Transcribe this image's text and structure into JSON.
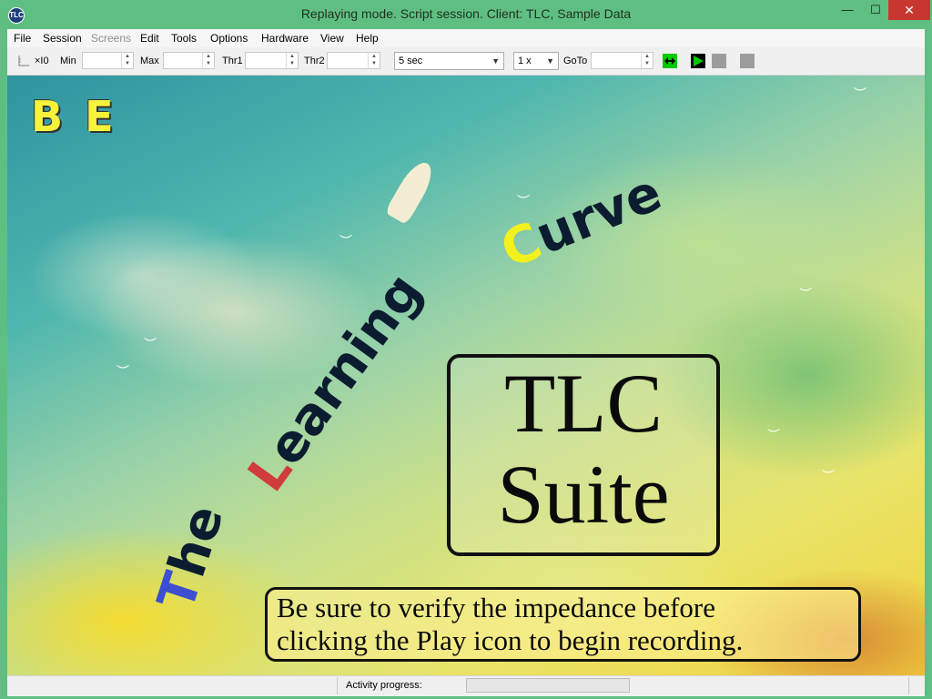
{
  "window": {
    "title": "Replaying mode. Script session. Client: TLC, Sample Data",
    "app_icon": "tlc-app-icon",
    "controls": {
      "minimize": "—",
      "maximize": "☐",
      "close": "✕"
    }
  },
  "menubar": {
    "items": [
      {
        "label": "File",
        "enabled": true
      },
      {
        "label": "Session",
        "enabled": true
      },
      {
        "label": "Screens",
        "enabled": false
      },
      {
        "label": "Edit",
        "enabled": true
      },
      {
        "label": "Tools",
        "enabled": true
      },
      {
        "label": "Options",
        "enabled": true
      },
      {
        "label": "Hardware",
        "enabled": true
      },
      {
        "label": "View",
        "enabled": true
      },
      {
        "label": "Help",
        "enabled": true
      }
    ]
  },
  "toolbar": {
    "scale_label": "×I0",
    "min_label": "Min",
    "min_value": "",
    "max_label": "Max",
    "max_value": "",
    "thr1_label": "Thr1",
    "thr1_value": "",
    "thr2_label": "Thr2",
    "thr2_value": "",
    "interval_selected": "5 sec",
    "speed_selected": "1 x",
    "goto_label": "GoTo",
    "goto_value": "",
    "icons": [
      "axis-icon",
      "swap-arrows-icon",
      "play-icon",
      "pause-icon",
      "stop-icon"
    ],
    "accent_green": "#00c800"
  },
  "splash": {
    "logo": "B E",
    "curve_words": [
      "The",
      "Learning",
      "Curve"
    ],
    "curve_letters": {
      "T": "#3d4fd0",
      "L": "#d03b3b",
      "C": "#f3f01c"
    },
    "tlc_line1": "TLC",
    "tlc_line2": "Suite",
    "note_line1": "Be sure to verify the impedance before",
    "note_line2": "clicking the Play icon to begin recording."
  },
  "statusbar": {
    "progress_label": "Activity progress:",
    "progress_value": 0
  }
}
